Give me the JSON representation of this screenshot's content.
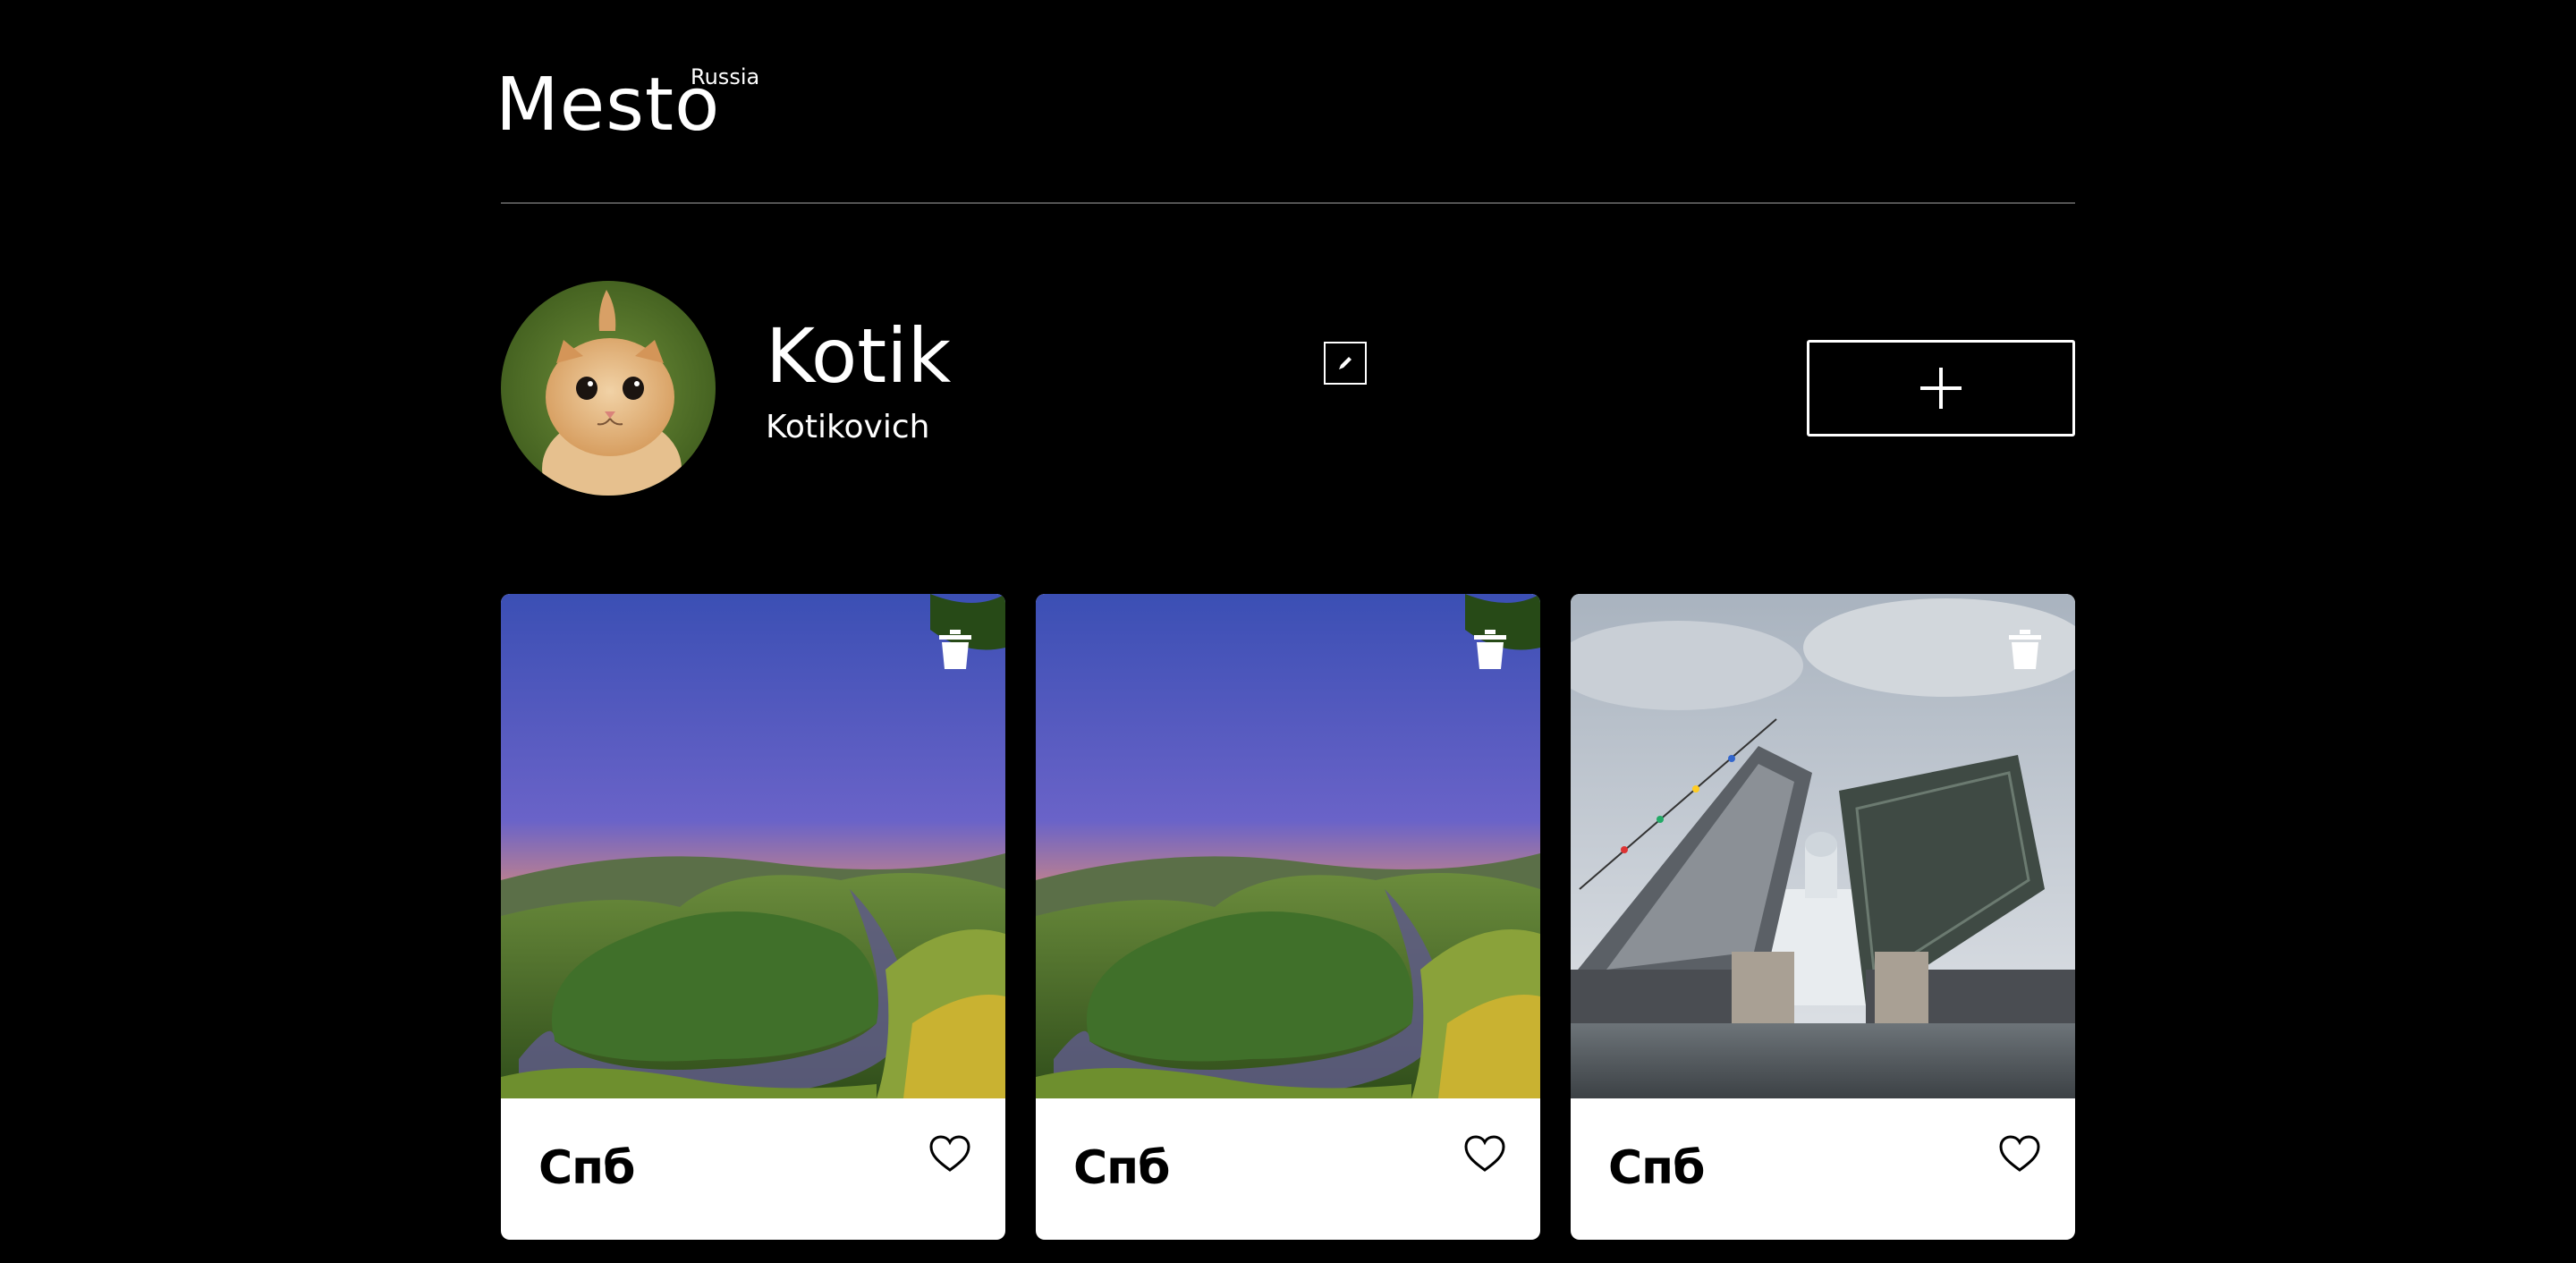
{
  "header": {
    "logo": "Mesto",
    "logo_sup": "Russia"
  },
  "profile": {
    "name": "Kotik",
    "about": "Kotikovich",
    "edit_icon": "pencil-icon",
    "add_icon": "plus-icon"
  },
  "cards": [
    {
      "title": "Спб",
      "image": "river-bend-landscape",
      "delete_icon": "trash-icon",
      "like_icon": "heart-icon"
    },
    {
      "title": "Спб",
      "image": "river-bend-landscape",
      "delete_icon": "trash-icon",
      "like_icon": "heart-icon"
    },
    {
      "title": "Спб",
      "image": "raised-drawbridge-st-petersburg",
      "delete_icon": "trash-icon",
      "like_icon": "heart-icon"
    }
  ],
  "colors": {
    "background": "#000000",
    "divider": "#545454",
    "card": "#ffffff",
    "text_light": "#ffffff",
    "text_dark": "#000000"
  }
}
